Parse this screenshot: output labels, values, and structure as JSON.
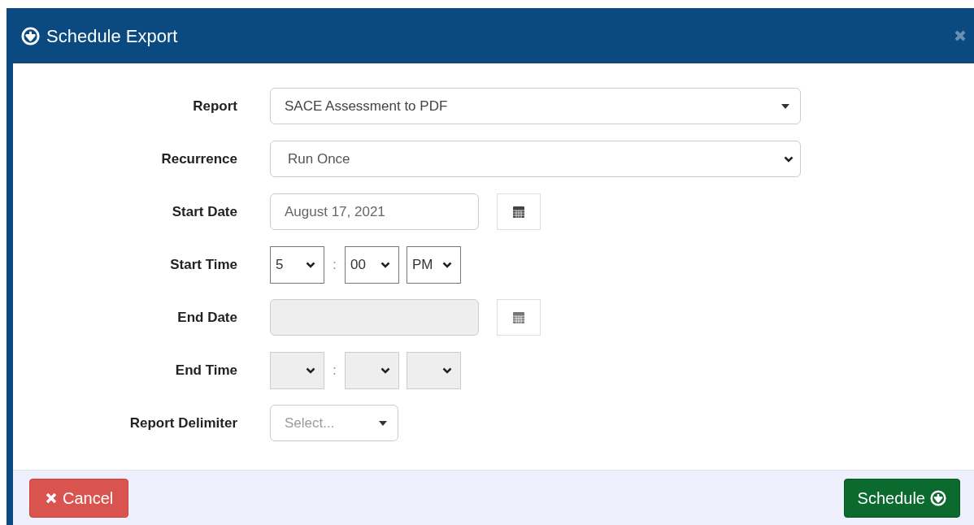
{
  "dialog": {
    "title": "Schedule Export"
  },
  "fields": [
    {
      "label": "Report",
      "kind": "dropdown",
      "value": "SACE Assessment to PDF"
    },
    {
      "label": "Recurrence",
      "kind": "select",
      "value": "Run Once"
    },
    {
      "label": "Start Date",
      "kind": "date",
      "value": "August 17, 2021",
      "disabled": false
    },
    {
      "label": "Start Time",
      "kind": "time",
      "separator": ":",
      "hour": "5",
      "minute": "00",
      "period": "PM",
      "disabled": false
    },
    {
      "label": "End Date",
      "kind": "date",
      "disabled": true
    },
    {
      "label": "End Time",
      "kind": "time",
      "separator": ":",
      "disabled": true
    },
    {
      "label": "Report Delimiter",
      "kind": "menu",
      "placeholder": "Select..."
    }
  ],
  "footer": {
    "cancel": "Cancel",
    "schedule": "Schedule"
  }
}
